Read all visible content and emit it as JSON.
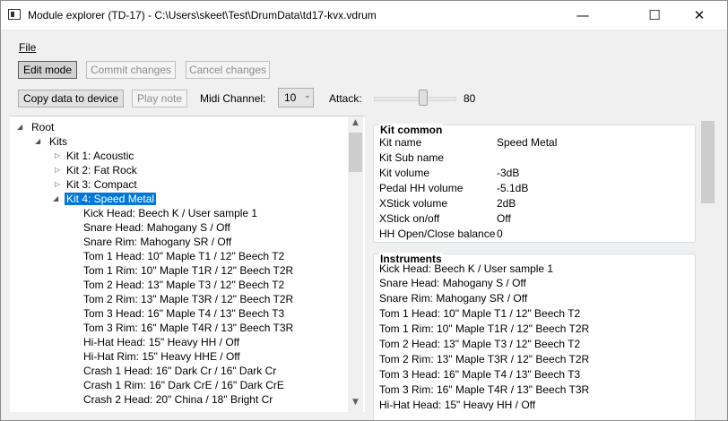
{
  "window": {
    "title": "Module explorer (TD-17) - C:\\Users\\skeet\\Test\\DrumData\\td17-kvx.vdrum",
    "minimize_glyph": "—",
    "maximize_glyph": "☐",
    "close_glyph": "✕"
  },
  "menu": {
    "file": "File"
  },
  "toolbar": {
    "edit_mode": "Edit mode",
    "commit_changes": "Commit changes",
    "cancel_changes": "Cancel changes",
    "copy_data": "Copy data to device",
    "play_note": "Play note",
    "midi_channel_label": "Midi Channel:",
    "midi_channel_value": "10",
    "attack_label": "Attack:",
    "attack_value": "80"
  },
  "tree": {
    "root": "Root",
    "kits": "Kits",
    "kit1": "Kit 1: Acoustic",
    "kit2": "Kit 2: Fat Rock",
    "kit3": "Kit 3: Compact",
    "kit4": "Kit 4: Speed Metal",
    "children": [
      "Kick Head: Beech K / User sample 1",
      "Snare Head: Mahogany S / Off",
      "Snare Rim: Mahogany SR / Off",
      "Tom 1 Head: 10\" Maple T1 / 12\" Beech T2",
      "Tom 1 Rim: 10\" Maple T1R / 12\" Beech T2R",
      "Tom 2 Head: 13\" Maple T3 / 12\" Beech T2",
      "Tom 2 Rim: 13\" Maple T3R / 12\" Beech T2R",
      "Tom 3 Head: 16\" Maple T4 / 13\" Beech T3",
      "Tom 3 Rim: 16\" Maple T4R / 13\" Beech T3R",
      "Hi-Hat Head: 15\" Heavy HH / Off",
      "Hi-Hat Rim: 15\" Heavy HHE / Off",
      "Crash 1 Head: 16\" Dark Cr / 16\" Dark Cr",
      "Crash 1 Rim: 16\" Dark CrE / 16\" Dark CrE",
      "Crash 2 Head: 20\" China / 18\" Bright Cr"
    ]
  },
  "kit_common": {
    "header": "Kit common",
    "rows": [
      {
        "label": "Kit name",
        "value": "Speed Metal"
      },
      {
        "label": "Kit Sub name",
        "value": ""
      },
      {
        "label": "Kit volume",
        "value": "-3dB"
      },
      {
        "label": "Pedal HH volume",
        "value": "-5.1dB"
      },
      {
        "label": "XStick volume",
        "value": "2dB"
      },
      {
        "label": "XStick on/off",
        "value": "Off"
      },
      {
        "label": "HH Open/Close balance",
        "value": "0"
      }
    ]
  },
  "instruments": {
    "header": "Instruments",
    "items": [
      "Kick Head: Beech K / User sample 1",
      "Snare Head: Mahogany S / Off",
      "Snare Rim: Mahogany SR / Off",
      "Tom 1 Head: 10\" Maple T1 / 12\" Beech T2",
      "Tom 1 Rim: 10\" Maple T1R / 12\" Beech T2R",
      "Tom 2 Head: 13\" Maple T3 / 12\" Beech T2",
      "Tom 2 Rim: 13\" Maple T3R / 12\" Beech T2R",
      "Tom 3 Head: 16\" Maple T4 / 13\" Beech T3",
      "Tom 3 Rim: 16\" Maple T4R / 13\" Beech T3R",
      "Hi-Hat Head: 15\" Heavy HH / Off"
    ]
  },
  "colors": {
    "selection": "#0078d7"
  }
}
